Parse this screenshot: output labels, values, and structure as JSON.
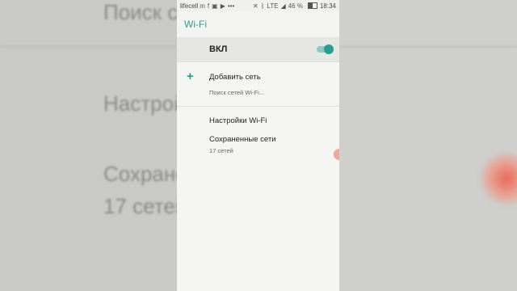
{
  "background": {
    "search_text": "Поиск с",
    "settings_text": "Настрой",
    "saved_text": "Сохранен",
    "count_text": "17 сетей"
  },
  "statusbar": {
    "carrier": "lifecell",
    "network": "LTE",
    "battery": "46 %",
    "time": "18:34"
  },
  "appbar": {
    "title": "Wi-Fi"
  },
  "toggle": {
    "label": "ВКЛ",
    "on": true
  },
  "menu": {
    "add_network": "Добавить сеть",
    "scanning": "Поиск сетей Wi-Fi...",
    "wifi_settings": "Настройки Wi-Fi",
    "saved_networks": "Сохраненные сети",
    "saved_count": "17 сетей"
  },
  "colors": {
    "accent": "#2a9d8f",
    "title": "#2f9c8e"
  }
}
